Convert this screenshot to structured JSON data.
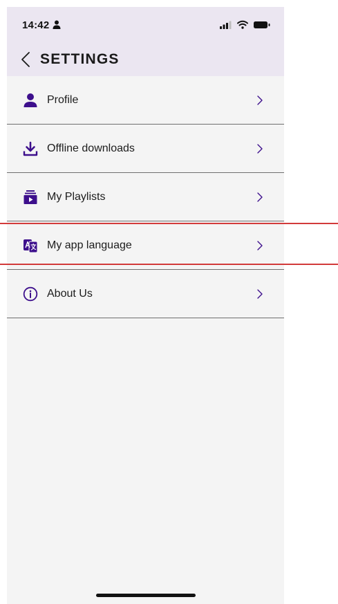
{
  "status_bar": {
    "time": "14:42"
  },
  "header": {
    "title": "SETTINGS"
  },
  "menu": {
    "items": [
      {
        "label": "Profile",
        "icon": "person-icon"
      },
      {
        "label": "Offline downloads",
        "icon": "download-icon"
      },
      {
        "label": "My Playlists",
        "icon": "playlist-icon"
      },
      {
        "label": "My app language",
        "icon": "translate-icon"
      },
      {
        "label": "About Us",
        "icon": "info-icon"
      }
    ]
  },
  "colors": {
    "accent": "#3d0f8c",
    "header_bg": "#ebe6f1",
    "page_bg": "#f4f4f4",
    "highlight": "#d23a3a"
  }
}
